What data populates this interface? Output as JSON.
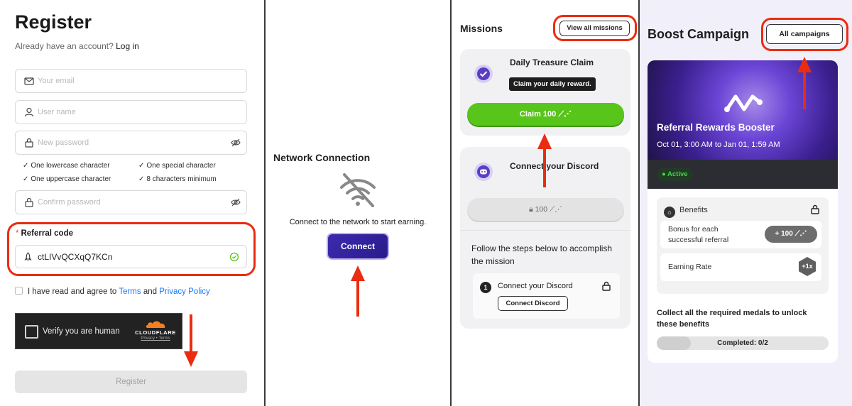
{
  "register": {
    "title": "Register",
    "already_text": "Already have an account?",
    "login_link": "Log in",
    "email_placeholder": "Your email",
    "username_placeholder": "User name",
    "password_placeholder": "New password",
    "requirements": [
      "One lowercase character",
      "One special character",
      "One uppercase character",
      "8 characters minimum"
    ],
    "confirm_placeholder": "Confirm password",
    "referral_label": "Referral code",
    "referral_required_mark": "*",
    "referral_value": "ctLIVvQCXqQ7KCn",
    "agree_prefix": "I have read and agree to",
    "terms_link": "Terms",
    "and_text": "and",
    "privacy_link": "Privacy Policy",
    "captcha_text": "Verify you are human",
    "captcha_brand": "CLOUDFLARE",
    "captcha_links": "Privacy • Terms",
    "register_button": "Register"
  },
  "network": {
    "title": "Network Connection",
    "description": "Connect to the network to start earning.",
    "connect_button": "Connect",
    "icon": "wifi-off-icon"
  },
  "missions": {
    "title": "Missions",
    "view_all_button": "View all missions",
    "items": [
      {
        "name": "Daily Treasure Claim",
        "tooltip": "Claim your daily reward.",
        "button": "Claim 100",
        "icon": "check-badge-icon"
      },
      {
        "name": "Connect your Discord",
        "locked_button": "100",
        "instructions": "Follow the steps below to accomplish the mission",
        "step_number": "1",
        "step_label": "Connect your Discord",
        "step_button": "Connect Discord",
        "icon": "discord-icon"
      }
    ]
  },
  "boost": {
    "title": "Boost Campaign",
    "all_button": "All campaigns",
    "campaign_name": "Referral Rewards Booster",
    "dates": "Oct 01, 3:00 AM to Jan 01, 1:59 AM",
    "status": "Active",
    "benefits_title": "Benefits",
    "benefit_rows": [
      {
        "label_line1": "Bonus for each",
        "label_line2": "successful referral",
        "value": "+ 100"
      },
      {
        "label_line1": "Earning Rate",
        "label_line2": "",
        "value": "+1x"
      }
    ],
    "collect_text": "Collect all the required medals to unlock these benefits",
    "progress_text": "Completed: 0/2",
    "progress_fraction": 0
  },
  "colors": {
    "highlight_red": "#ea2c10",
    "claim_green": "#58c51a",
    "connect_purple": "#3d2ab0",
    "link_blue": "#1677ff",
    "active_green": "#47d14e"
  }
}
